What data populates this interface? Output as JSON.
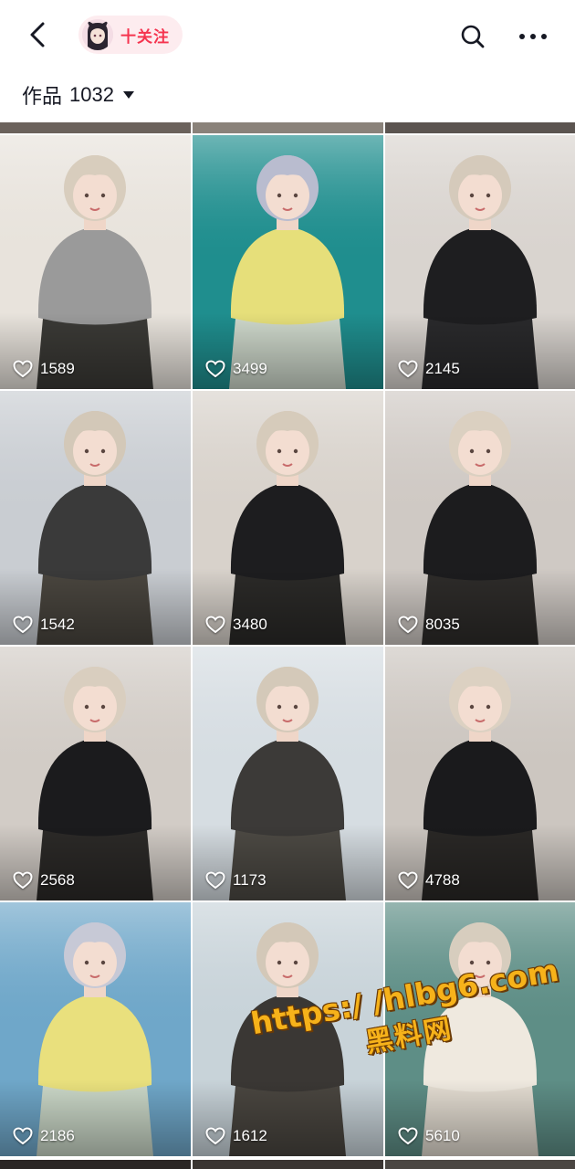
{
  "header": {
    "follow_label": "十关注",
    "works_label": "作品",
    "works_count": "1032",
    "icons": [
      "back-chevron-icon",
      "avatar",
      "search-icon",
      "more-dots-icon",
      "dropdown-caret-icon"
    ]
  },
  "grid": {
    "heart_icon": "heart-outline-icon",
    "tiles": [
      {
        "likes": "1589",
        "bg": "#e8e3dc",
        "top": "#9a9a9a",
        "bottom": "#3b3a36",
        "hair": "#d8cdbd"
      },
      {
        "likes": "3499",
        "bg": "#1f8e8e",
        "top": "#e6df7a",
        "bottom": "#cfd9cc",
        "hair": "#b9bccf"
      },
      {
        "likes": "2145",
        "bg": "#d9d4cf",
        "top": "#1e1e20",
        "bottom": "#2a2a2c",
        "hair": "#d5cabb"
      },
      {
        "likes": "1542",
        "bg": "#c9cdd2",
        "top": "#3a3a3a",
        "bottom": "#4a463f",
        "hair": "#d3c8b8"
      },
      {
        "likes": "3480",
        "bg": "#d8d2cb",
        "top": "#1d1d1f",
        "bottom": "#2b2a28",
        "hair": "#d6cbbb"
      },
      {
        "likes": "8035",
        "bg": "#cfc9c4",
        "top": "#1c1c1e",
        "bottom": "#2e2c2a",
        "hair": "#dbd0c1"
      },
      {
        "likes": "2568",
        "bg": "#d2ccc6",
        "top": "#1b1b1d",
        "bottom": "#2c2a28",
        "hair": "#d9cebf"
      },
      {
        "likes": "1173",
        "bg": "#d6dde2",
        "top": "#3c3a38",
        "bottom": "#4d4a44",
        "hair": "#d4c9b9"
      },
      {
        "likes": "4788",
        "bg": "#ccc6c0",
        "top": "#1a1a1c",
        "bottom": "#2a2826",
        "hair": "#dcd1c2"
      },
      {
        "likes": "2186",
        "bg": "#6fa7c9",
        "top": "#e9e07d",
        "bottom": "#cbd8c8",
        "hair": "#c7c9d6"
      },
      {
        "likes": "1612",
        "bg": "#c8d3d9",
        "top": "#3a3734",
        "bottom": "#4a4640",
        "hair": "#d3c8b8"
      },
      {
        "likes": "5610",
        "bg": "#5e8e86",
        "top": "#efe9df",
        "bottom": "#e4ddd2",
        "hair": "#d7cdbe"
      }
    ]
  },
  "watermark": {
    "url": "https:/ /hlbg6.com",
    "name": "黑料网"
  }
}
